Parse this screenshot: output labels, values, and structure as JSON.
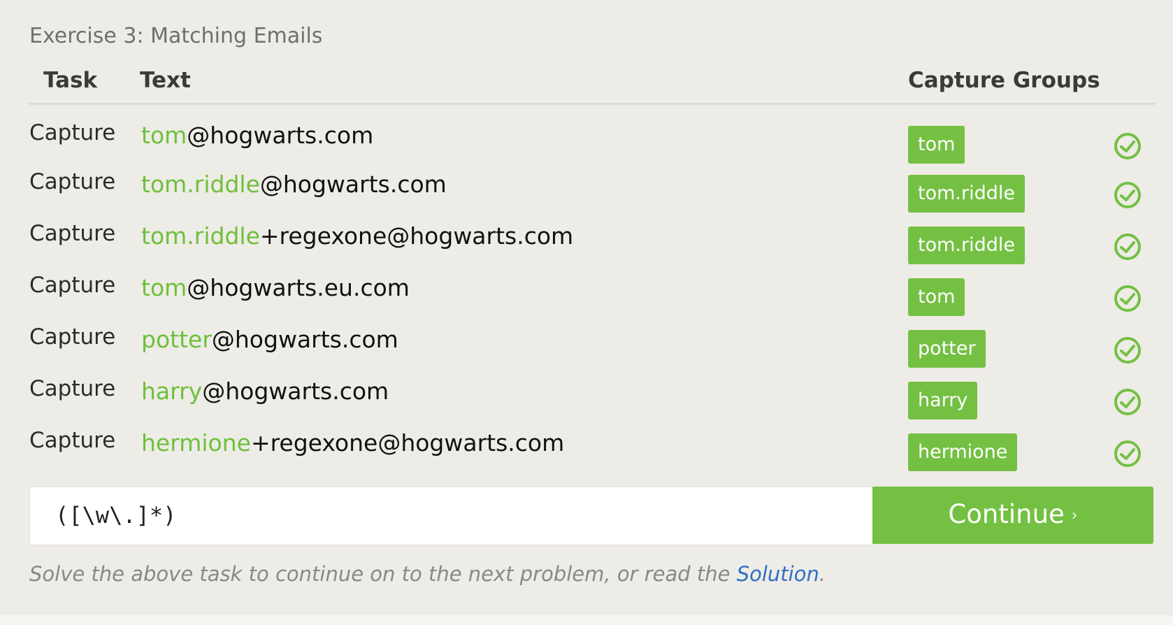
{
  "exercise_title": "Exercise 3: Matching Emails",
  "headers": {
    "task": "Task",
    "text": "Text",
    "capture": "Capture Groups"
  },
  "rows": [
    {
      "task": "Capture",
      "match": "tom",
      "rest": "@hogwarts.com",
      "group": "tom"
    },
    {
      "task": "Capture",
      "match": "tom.riddle",
      "rest": "@hogwarts.com",
      "group": "tom.riddle"
    },
    {
      "task": "Capture",
      "match": "tom.riddle",
      "rest": "+regexone@hogwarts.com",
      "group": "tom.riddle"
    },
    {
      "task": "Capture",
      "match": "tom",
      "rest": "@hogwarts.eu.com",
      "group": "tom"
    },
    {
      "task": "Capture",
      "match": "potter",
      "rest": "@hogwarts.com",
      "group": "potter"
    },
    {
      "task": "Capture",
      "match": "harry",
      "rest": "@hogwarts.com",
      "group": "harry"
    },
    {
      "task": "Capture",
      "match": "hermione",
      "rest": "+regexone@hogwarts.com",
      "group": "hermione"
    }
  ],
  "regex_input": {
    "value": "([\\w\\.]*)"
  },
  "continue_button": {
    "label": "Continue",
    "chevron": "›"
  },
  "footer": {
    "text_before": "Solve the above task to continue on to the next problem, or read the ",
    "link": "Solution",
    "text_after": "."
  },
  "icons": {
    "row_status": "check-circle-icon"
  },
  "colors": {
    "accent_green": "#74c043",
    "link_blue": "#2f6fc6"
  }
}
